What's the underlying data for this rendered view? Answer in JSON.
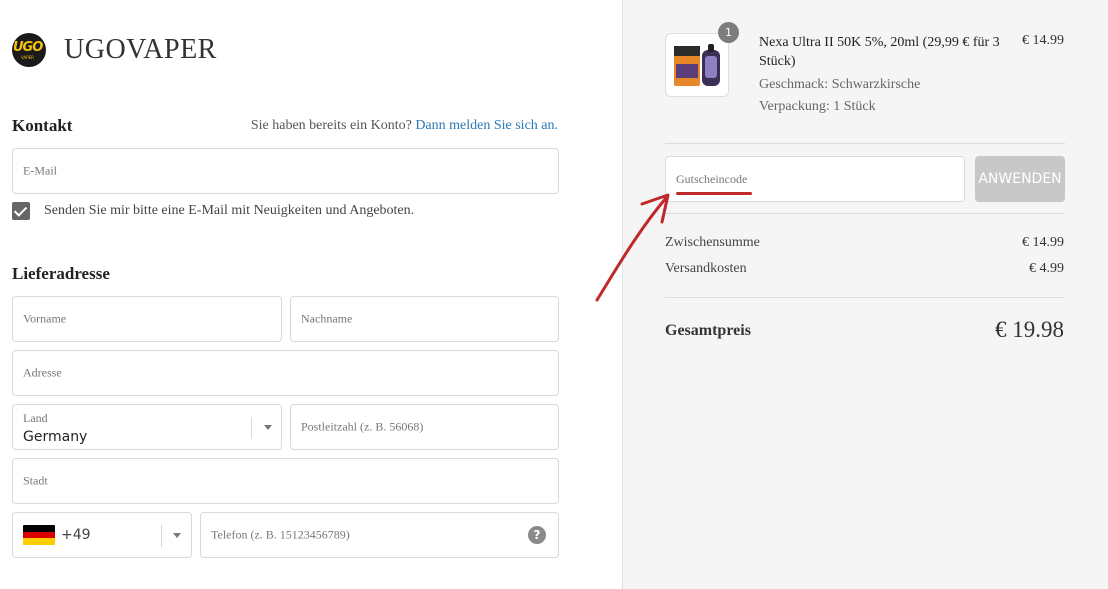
{
  "brand": {
    "name": "UGOVAPER",
    "badge_text": "UGO",
    "badge_sub": "VAPER",
    "badge_color": "#f4c20d"
  },
  "contact": {
    "title": "Kontakt",
    "login_prompt": "Sie haben bereits ein Konto?",
    "login_link": "Dann melden Sie sich an.",
    "email_placeholder": "E-Mail",
    "newsletter_label": "Senden Sie mir bitte eine E-Mail mit Neuigkeiten und Angeboten.",
    "newsletter_checked": true
  },
  "shipping": {
    "title": "Lieferadresse",
    "first_name_placeholder": "Vorname",
    "last_name_placeholder": "Nachname",
    "address_placeholder": "Adresse",
    "country_label": "Land",
    "country_value": "Germany",
    "zip_placeholder": "Postleitzahl (z. B. 56068)",
    "city_placeholder": "Stadt",
    "dial_code": "+49",
    "phone_placeholder": "Telefon (z. B. 15123456789)",
    "help_glyph": "?"
  },
  "cart": {
    "item": {
      "quantity": "1",
      "name": "Nexa Ultra II 50K 5%, 20ml (29,99 € für 3 Stück)",
      "price": "€ 14.99",
      "flavor": "Geschmack: Schwarzkirsche",
      "packaging": "Verpackung: 1 Stück",
      "thumb_label": "NEXA"
    },
    "coupon_placeholder": "Gutscheincode",
    "apply_label": "ANWENDEN",
    "subtotal_label": "Zwischensumme",
    "subtotal_value": "€ 14.99",
    "shipping_label": "Versandkosten",
    "shipping_value": "€ 4.99",
    "total_label": "Gesamtpreis",
    "total_value": "€ 19.98"
  },
  "colors": {
    "link": "#2a79b8",
    "annotation_red": "#c0282a",
    "button_disabled": "#c8c8c8"
  },
  "icons": [
    "checkmark-icon",
    "chevron-down-icon",
    "germany-flag-icon",
    "help-icon",
    "annotation-arrow-icon"
  ]
}
